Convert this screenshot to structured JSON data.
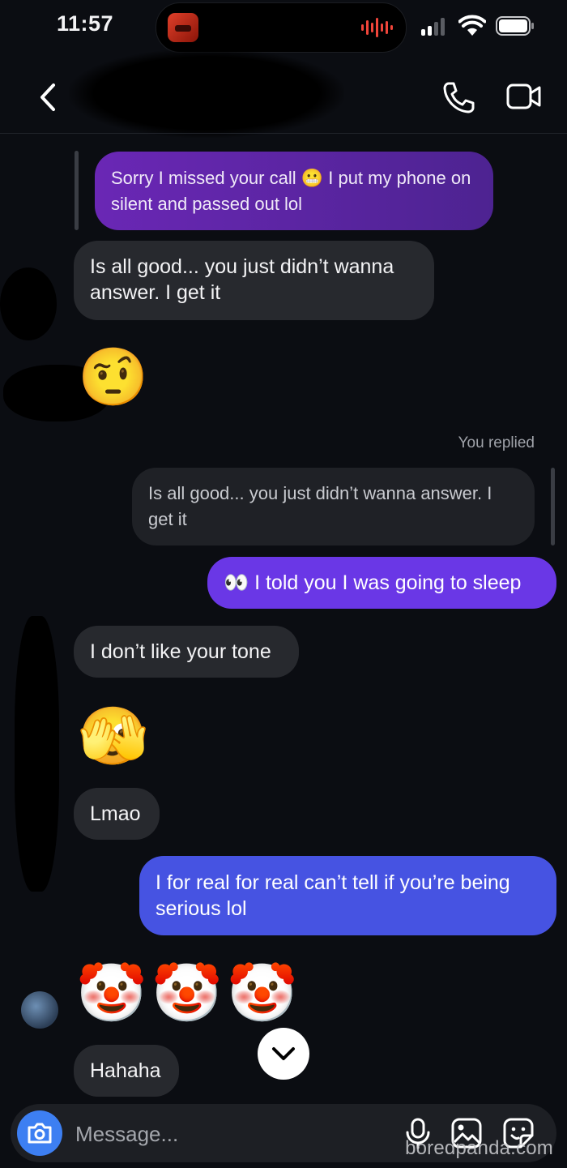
{
  "status_bar": {
    "time": "11:57"
  },
  "header": {
    "icons": [
      "back-arrow-icon",
      "phone-icon",
      "video-camera-icon"
    ]
  },
  "messages": {
    "m1": "Sorry I missed your call 😬 I put my phone on silent and passed out lol",
    "m2": "Is all good... you just didn’t wanna answer. I get it",
    "m3_emoji": "🤨",
    "replied_label": "You replied",
    "m4_quote": "Is all good... you just didn’t wanna answer. I get it",
    "m5": "👀 I told you I was going to sleep",
    "m6": "I don’t like your tone",
    "m7_emoji": "🫣",
    "m8": "Lmao",
    "m9": "I for real for real can’t tell if you’re being serious lol",
    "m10_emoji": "🤡🤡🤡",
    "m11": "Hahaha"
  },
  "composer": {
    "placeholder": "Message..."
  },
  "watermark": "boredpanda.com",
  "colors": {
    "background": "#0b0d12",
    "incoming_bubble": "#27292e",
    "outgoing_purple": "#5b25a4",
    "outgoing_violet": "#6a37e6",
    "outgoing_blue": "#4653e2",
    "camera_button": "#3d7ff2"
  }
}
